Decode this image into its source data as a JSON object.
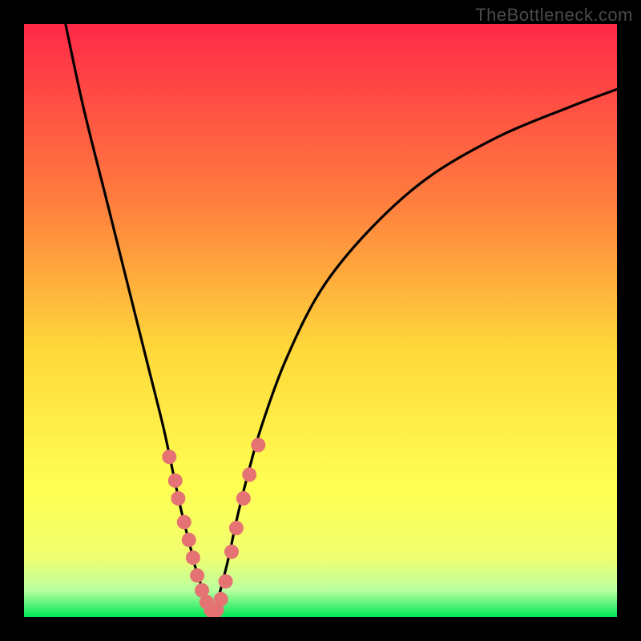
{
  "watermark": "TheBottleneck.com",
  "colors": {
    "frame": "#000000",
    "gradient_top": "#ff2948",
    "gradient_mid1": "#ff7e3e",
    "gradient_mid2": "#ffd83a",
    "gradient_mid3": "#ffff52",
    "gradient_mid4": "#f0ff70",
    "gradient_bottom": "#00e756",
    "curve": "#000000",
    "dots": "#e57373"
  },
  "chart_data": {
    "type": "line",
    "title": "",
    "xlabel": "",
    "ylabel": "",
    "xlim": [
      0,
      100
    ],
    "ylim": [
      0,
      100
    ],
    "series": [
      {
        "name": "left-curve",
        "x": [
          7,
          10,
          14,
          18,
          21,
          23.5,
          25,
          26.5,
          28,
          29,
          30,
          31,
          32
        ],
        "values": [
          100,
          86,
          70,
          54,
          42,
          32,
          25,
          18,
          12,
          8,
          5,
          2.5,
          0
        ]
      },
      {
        "name": "right-curve",
        "x": [
          32,
          33,
          34.5,
          36,
          38,
          40,
          44,
          50,
          58,
          68,
          80,
          92,
          100
        ],
        "values": [
          0,
          4,
          10,
          17,
          25,
          32,
          43,
          55,
          65,
          74,
          81,
          86,
          89
        ]
      }
    ],
    "dots": {
      "name": "highlight-points",
      "points": [
        {
          "x": 24.5,
          "y": 27
        },
        {
          "x": 25.5,
          "y": 23
        },
        {
          "x": 26.0,
          "y": 20
        },
        {
          "x": 27.0,
          "y": 16
        },
        {
          "x": 27.8,
          "y": 13
        },
        {
          "x": 28.5,
          "y": 10
        },
        {
          "x": 29.2,
          "y": 7
        },
        {
          "x": 30.0,
          "y": 4.5
        },
        {
          "x": 30.8,
          "y": 2.5
        },
        {
          "x": 31.5,
          "y": 1.2
        },
        {
          "x": 32.0,
          "y": 0.5
        },
        {
          "x": 32.5,
          "y": 1.2
        },
        {
          "x": 33.2,
          "y": 3
        },
        {
          "x": 34.0,
          "y": 6
        },
        {
          "x": 35.0,
          "y": 11
        },
        {
          "x": 35.8,
          "y": 15
        },
        {
          "x": 37.0,
          "y": 20
        },
        {
          "x": 38.0,
          "y": 24
        },
        {
          "x": 39.5,
          "y": 29
        }
      ]
    },
    "gradient_stops": [
      {
        "offset": 0.0,
        "color": "#ff2948"
      },
      {
        "offset": 0.3,
        "color": "#ff7e3e"
      },
      {
        "offset": 0.55,
        "color": "#ffd83a"
      },
      {
        "offset": 0.78,
        "color": "#ffff52"
      },
      {
        "offset": 0.9,
        "color": "#f0ff70"
      },
      {
        "offset": 0.955,
        "color": "#baffa0"
      },
      {
        "offset": 1.0,
        "color": "#00e756"
      }
    ]
  }
}
